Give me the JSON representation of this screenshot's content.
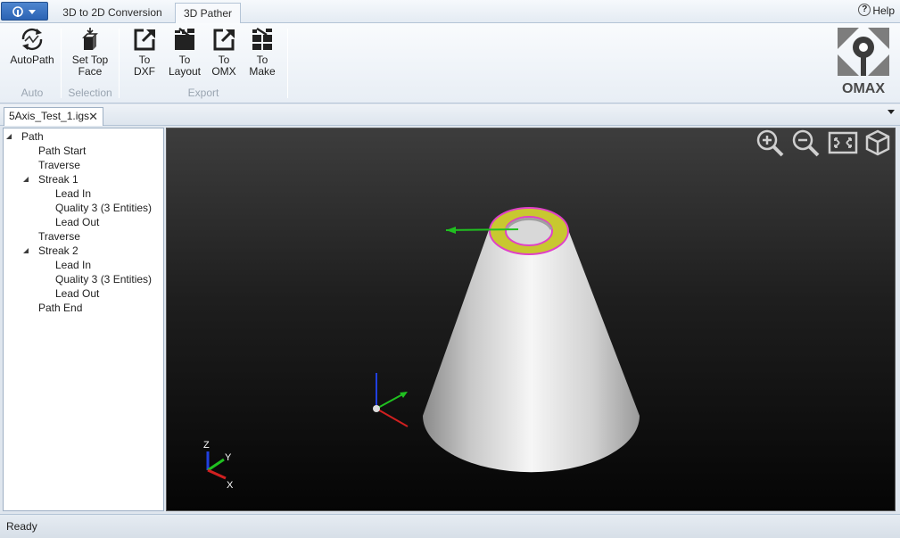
{
  "ribbon": {
    "tabs": [
      "3D to 2D Conversion",
      "3D Pather"
    ],
    "active_tab": "3D Pather",
    "help_label": "Help",
    "buttons": {
      "autopath": "AutoPath",
      "set_top_face": [
        "Set Top",
        "Face"
      ],
      "to_dxf": [
        "To",
        "DXF"
      ],
      "to_layout": [
        "To",
        "Layout"
      ],
      "to_omx": [
        "To",
        "OMX"
      ],
      "to_make": [
        "To",
        "Make"
      ]
    },
    "groups": {
      "auto": "Auto",
      "selection": "Selection",
      "export": "Export"
    },
    "brand": "OMAX"
  },
  "document": {
    "tab_name": "5Axis_Test_1.igs",
    "close_glyph": "✕"
  },
  "tree": [
    {
      "label": "Path",
      "level": 0,
      "expanded": true
    },
    {
      "label": "Path Start",
      "level": 1
    },
    {
      "label": "Traverse",
      "level": 1
    },
    {
      "label": "Streak 1",
      "level": 1,
      "expanded": true
    },
    {
      "label": "Lead In",
      "level": 2
    },
    {
      "label": "Quality 3 (3 Entities)",
      "level": 2
    },
    {
      "label": "Lead Out",
      "level": 2
    },
    {
      "label": "Traverse",
      "level": 1
    },
    {
      "label": "Streak 2",
      "level": 1,
      "expanded": true
    },
    {
      "label": "Lead In",
      "level": 2
    },
    {
      "label": "Quality 3 (3 Entities)",
      "level": 2
    },
    {
      "label": "Lead Out",
      "level": 2
    },
    {
      "label": "Path End",
      "level": 1
    }
  ],
  "viewport": {
    "axis_labels": {
      "z": "Z",
      "y": "Y",
      "x": "X"
    },
    "controls": [
      "zoom-in-icon",
      "zoom-out-icon",
      "zoom-extents-icon",
      "view-cube-icon"
    ]
  },
  "status": {
    "text": "Ready"
  },
  "colors": {
    "ring_fill": "#c8c830",
    "ring_edge": "#e040c8",
    "axis_x": "#d02020",
    "axis_y": "#20c020",
    "axis_z": "#2040e0",
    "cone": "#e0e0e0"
  }
}
